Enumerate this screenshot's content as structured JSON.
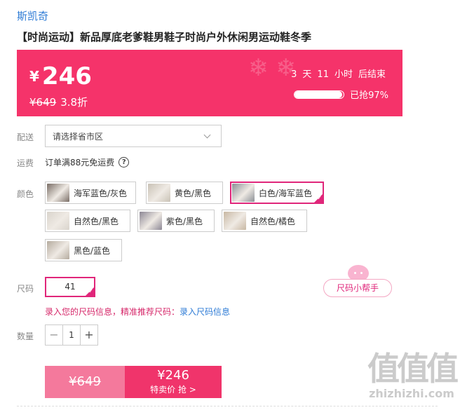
{
  "brand": "斯凯奇",
  "title": "【时尚运动】新品厚底老爹鞋男鞋子时尚户外休闲男运动鞋冬季",
  "banner": {
    "currency": "¥",
    "price": "246",
    "original_price": "¥649",
    "discount": "3.8折",
    "countdown": {
      "days": "3",
      "days_unit": "天",
      "hours": "11",
      "hours_unit": "小时",
      "suffix": "后结束"
    },
    "sold_label": "已抢97%",
    "sold_fraction": 0.97
  },
  "delivery": {
    "label": "配送",
    "placeholder": "请选择省市区"
  },
  "shipping": {
    "label": "运费",
    "text": "订单满88元免运费",
    "help_symbol": "?"
  },
  "colors": {
    "label": "颜色",
    "options": [
      {
        "label": "海军蓝色/灰色",
        "swatch": "#7a6e66",
        "selected": false
      },
      {
        "label": "黄色/黑色",
        "swatch": "#c9c2b6",
        "selected": false
      },
      {
        "label": "白色/海军蓝色",
        "swatch": "#8b8f96",
        "selected": true
      },
      {
        "label": "自然色/黑色",
        "swatch": "#d9d4cc",
        "selected": false
      },
      {
        "label": "紫色/黑色",
        "swatch": "#8c8794",
        "selected": false
      },
      {
        "label": "自然色/橘色",
        "swatch": "#c8b8a3",
        "selected": false
      },
      {
        "label": "黑色/蓝色",
        "swatch": "#b5ab9e",
        "selected": false
      }
    ]
  },
  "size": {
    "label": "尺码",
    "value": "41",
    "helper_label": "尺码小帮手",
    "hint": "录入您的尺码信息，精准推荐尺码：",
    "hint_link": "录入尺码信息"
  },
  "quantity": {
    "label": "数量",
    "minus": "−",
    "value": "1",
    "plus": "+"
  },
  "buy": {
    "original": "¥649",
    "price": "¥246",
    "action": "特卖价 抢 >"
  },
  "watermark": {
    "big": "值值值",
    "small": "zhizhizhi.com"
  },
  "accent_color": "#f5336a"
}
